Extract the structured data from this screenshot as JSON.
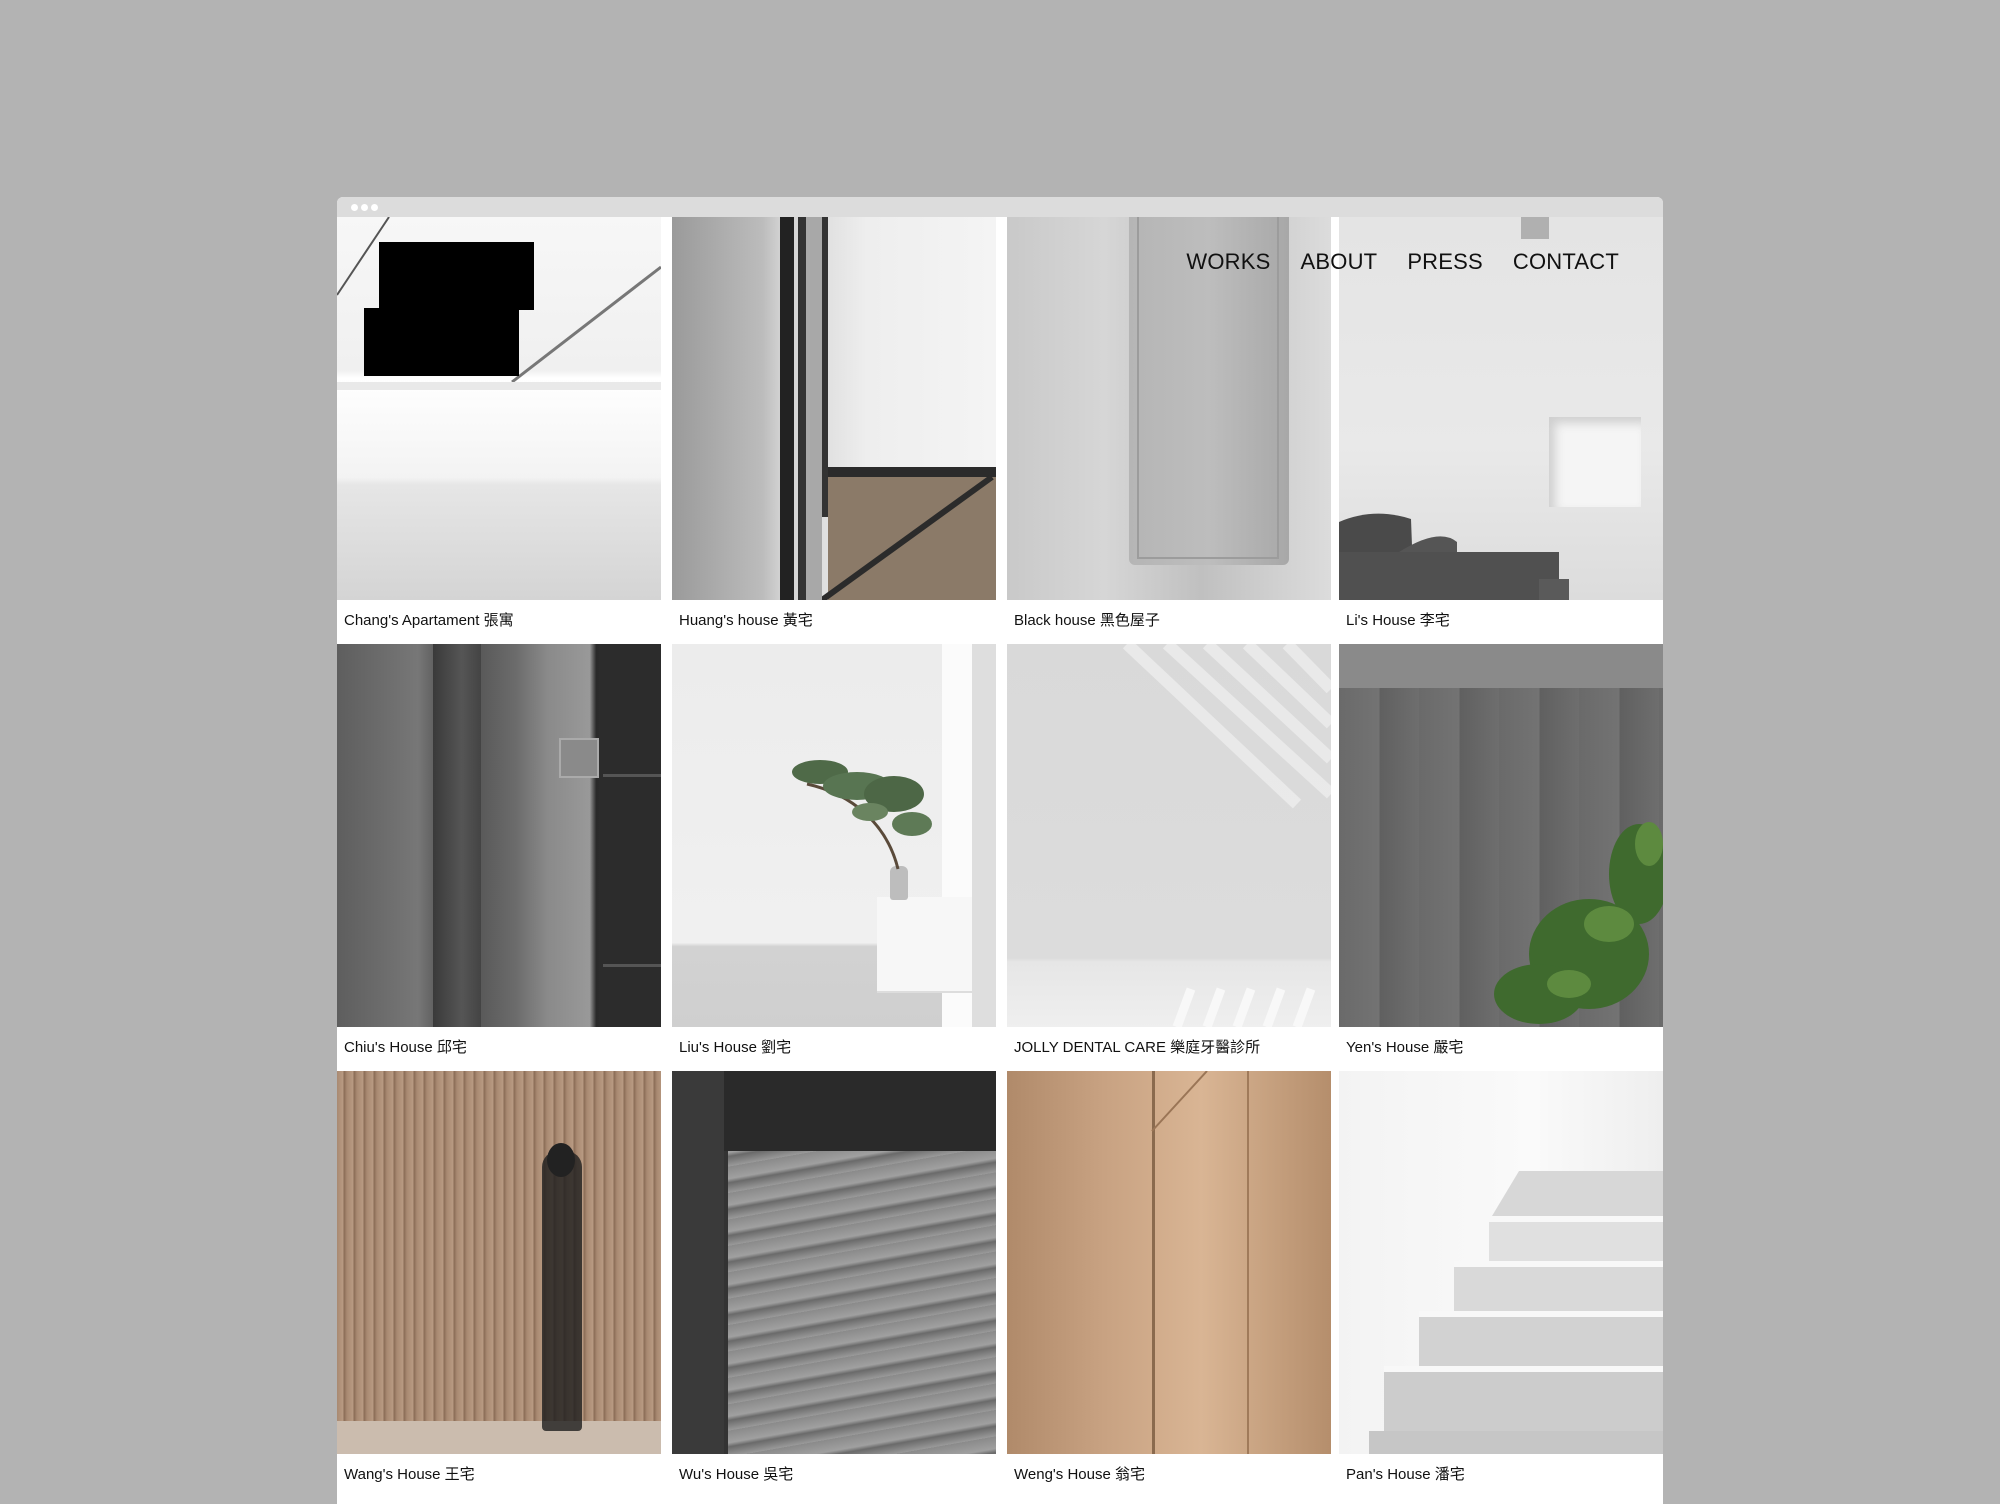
{
  "nav": {
    "items": [
      "WORKS",
      "ABOUT",
      "PRESS",
      "CONTACT"
    ]
  },
  "projects": [
    {
      "title": "Chang's Apartament 張寓"
    },
    {
      "title": "Huang's house 黃宅"
    },
    {
      "title": "Black house 黑色屋子"
    },
    {
      "title": "Li's House 李宅"
    },
    {
      "title": "Chiu's House 邱宅"
    },
    {
      "title": "Liu's House 劉宅"
    },
    {
      "title": "JOLLY DENTAL CARE 樂庭牙醫診所"
    },
    {
      "title": "Yen's House 嚴宅"
    },
    {
      "title": "Wang's House 王宅"
    },
    {
      "title": "Wu's House 吳宅"
    },
    {
      "title": "Weng's House 翁宅"
    },
    {
      "title": "Pan's House 潘宅"
    }
  ],
  "colors": {
    "background": "#b3b3b3",
    "page": "#ffffff",
    "titlebar": "#dcdcdc",
    "logo": "#000000"
  }
}
